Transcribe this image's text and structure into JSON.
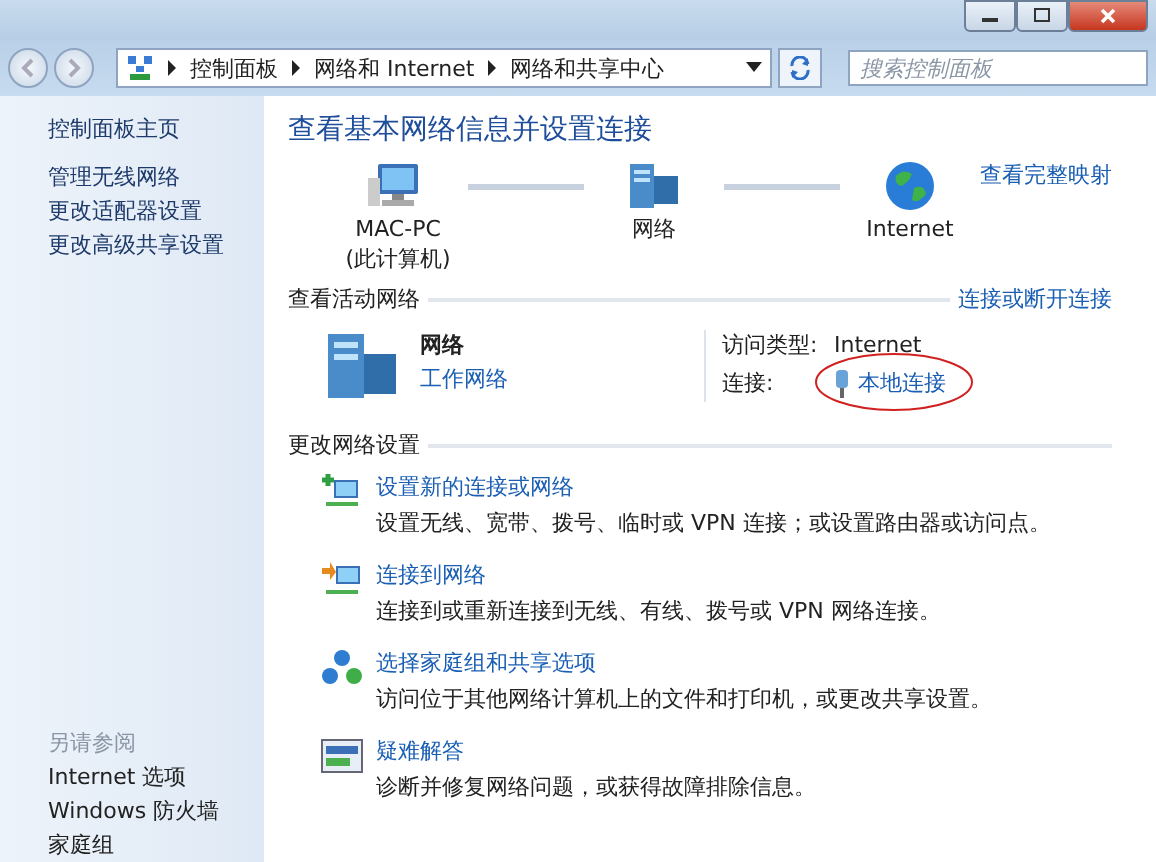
{
  "address_bar": {
    "breadcrumbs": [
      "控制面板",
      "网络和 Internet",
      "网络和共享中心"
    ]
  },
  "search": {
    "placeholder": "搜索控制面板"
  },
  "sidebar": {
    "home": "控制面板主页",
    "links": [
      "管理无线网络",
      "更改适配器设置",
      "更改高级共享设置"
    ],
    "see_also": {
      "heading": "另请参阅",
      "links": [
        "Internet 选项",
        "Windows 防火墙",
        "家庭组"
      ]
    }
  },
  "main": {
    "title": "查看基本网络信息并设置连接",
    "full_map_link": "查看完整映射",
    "network_map": [
      {
        "kind": "computer",
        "label": "MAC-PC",
        "sublabel": "(此计算机)"
      },
      {
        "kind": "network",
        "label": "网络"
      },
      {
        "kind": "internet",
        "label": "Internet"
      }
    ],
    "active_networks": {
      "heading": "查看活动网络",
      "link": "连接或断开连接",
      "name": "网络",
      "type": "工作网络",
      "access_type_label": "访问类型:",
      "access_type": "Internet",
      "connection_label": "连接:",
      "connection": "本地连接",
      "highlighted": true
    },
    "change_settings": {
      "heading": "更改网络设置",
      "tasks": [
        {
          "kind": "new-connection",
          "title": "设置新的连接或网络",
          "description": "设置无线、宽带、拨号、临时或 VPN 连接；或设置路由器或访问点。"
        },
        {
          "kind": "connect",
          "title": "连接到网络",
          "description": "连接到或重新连接到无线、有线、拨号或 VPN 网络连接。"
        },
        {
          "kind": "homegroup",
          "title": "选择家庭组和共享选项",
          "description": "访问位于其他网络计算机上的文件和打印机，或更改共享设置。"
        },
        {
          "kind": "troubleshoot",
          "title": "疑难解答",
          "description": "诊断并修复网络问题，或获得故障排除信息。"
        }
      ]
    }
  }
}
